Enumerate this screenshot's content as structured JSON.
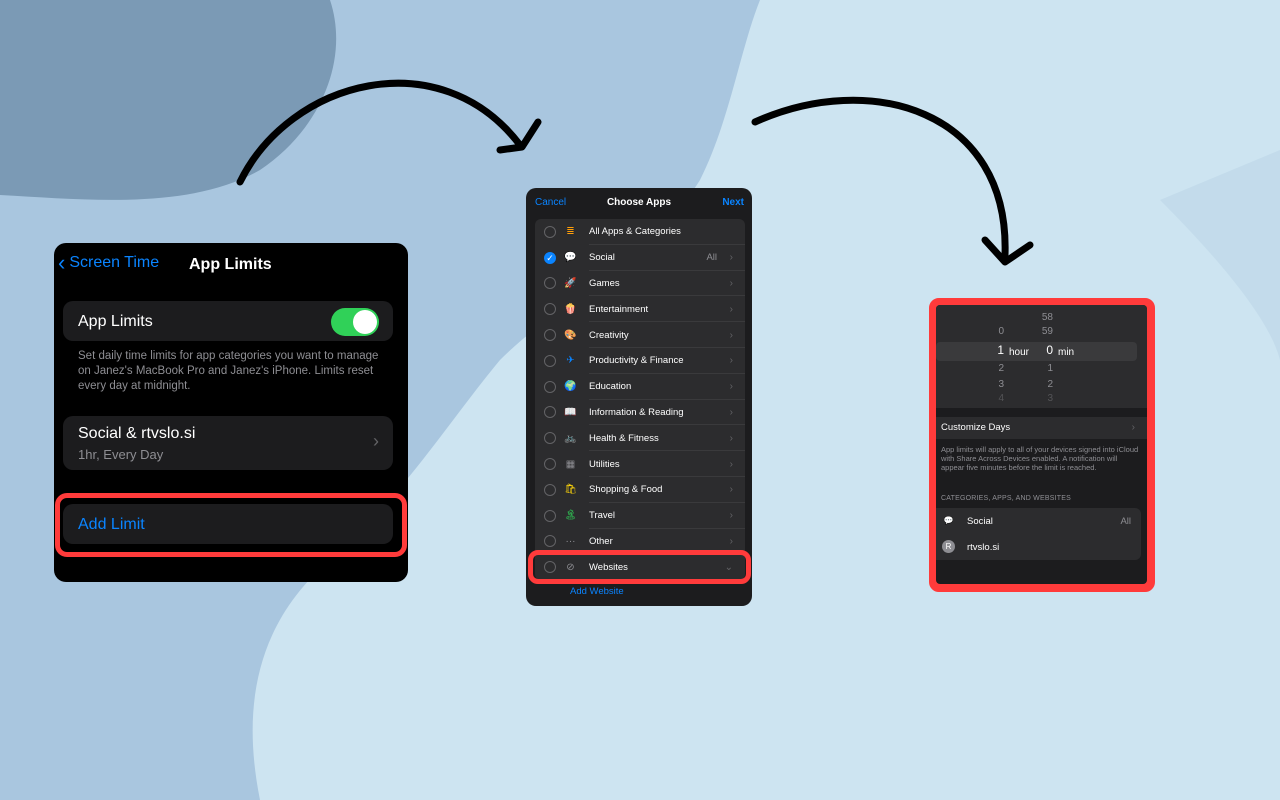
{
  "colors": {
    "background": "#a9c6df",
    "accent": "#0a84ff",
    "toggle_on": "#30d158",
    "highlight": "#ff3b3b"
  },
  "panel1": {
    "back_label": "Screen Time",
    "title": "App Limits",
    "toggle_label": "App Limits",
    "toggle_on": true,
    "description": "Set daily time limits for app categories you want to manage on Janez's MacBook Pro and Janez's iPhone. Limits reset every day at midnight.",
    "limit_name": "Social & rtvslo.si",
    "limit_detail": "1hr, Every Day",
    "add_limit": "Add Limit"
  },
  "panel2": {
    "cancel": "Cancel",
    "title": "Choose Apps",
    "next": "Next",
    "items": [
      {
        "label": "All Apps & Categories",
        "icon": "stack-icon",
        "checked": false,
        "all": "",
        "chevron": ""
      },
      {
        "label": "Social",
        "icon": "social-icon",
        "checked": true,
        "all": "All",
        "chevron": "›"
      },
      {
        "label": "Games",
        "icon": "rocket-icon",
        "checked": false,
        "all": "",
        "chevron": "›"
      },
      {
        "label": "Entertainment",
        "icon": "popcorn-icon",
        "checked": false,
        "all": "",
        "chevron": "›"
      },
      {
        "label": "Creativity",
        "icon": "palette-icon",
        "checked": false,
        "all": "",
        "chevron": "›"
      },
      {
        "label": "Productivity & Finance",
        "icon": "paperplane-icon",
        "checked": false,
        "all": "",
        "chevron": "›"
      },
      {
        "label": "Education",
        "icon": "globe-icon",
        "checked": false,
        "all": "",
        "chevron": "›"
      },
      {
        "label": "Information & Reading",
        "icon": "book-icon",
        "checked": false,
        "all": "",
        "chevron": "›"
      },
      {
        "label": "Health & Fitness",
        "icon": "bike-icon",
        "checked": false,
        "all": "",
        "chevron": "›"
      },
      {
        "label": "Utilities",
        "icon": "calculator-icon",
        "checked": false,
        "all": "",
        "chevron": "›"
      },
      {
        "label": "Shopping & Food",
        "icon": "shopping-icon",
        "checked": false,
        "all": "",
        "chevron": "›"
      },
      {
        "label": "Travel",
        "icon": "beach-icon",
        "checked": false,
        "all": "",
        "chevron": "›"
      },
      {
        "label": "Other",
        "icon": "ellipsis-icon",
        "checked": false,
        "all": "",
        "chevron": "›"
      },
      {
        "label": "Websites",
        "icon": "compass-icon",
        "checked": false,
        "all": "",
        "chevron": "⌄"
      }
    ],
    "add_website": "Add Website"
  },
  "panel3": {
    "picker": {
      "hours": [
        "",
        "0",
        "1",
        "2",
        "3",
        "4"
      ],
      "minutes": [
        "58",
        "59",
        "0",
        "1",
        "2",
        "3"
      ],
      "hour_unit": "hour",
      "min_unit": "min"
    },
    "customize_days": "Customize Days",
    "note": "App limits will apply to all of your devices signed into iCloud with Share Across Devices enabled. A notification will appear five minutes before the limit is reached.",
    "section_header": "CATEGORIES, APPS, AND WEBSITES",
    "items": [
      {
        "label": "Social",
        "icon": "social-icon",
        "badge": "",
        "all": "All"
      },
      {
        "label": "rtvslo.si",
        "icon": "letter-avatar-icon",
        "badge": "R",
        "all": ""
      }
    ]
  }
}
